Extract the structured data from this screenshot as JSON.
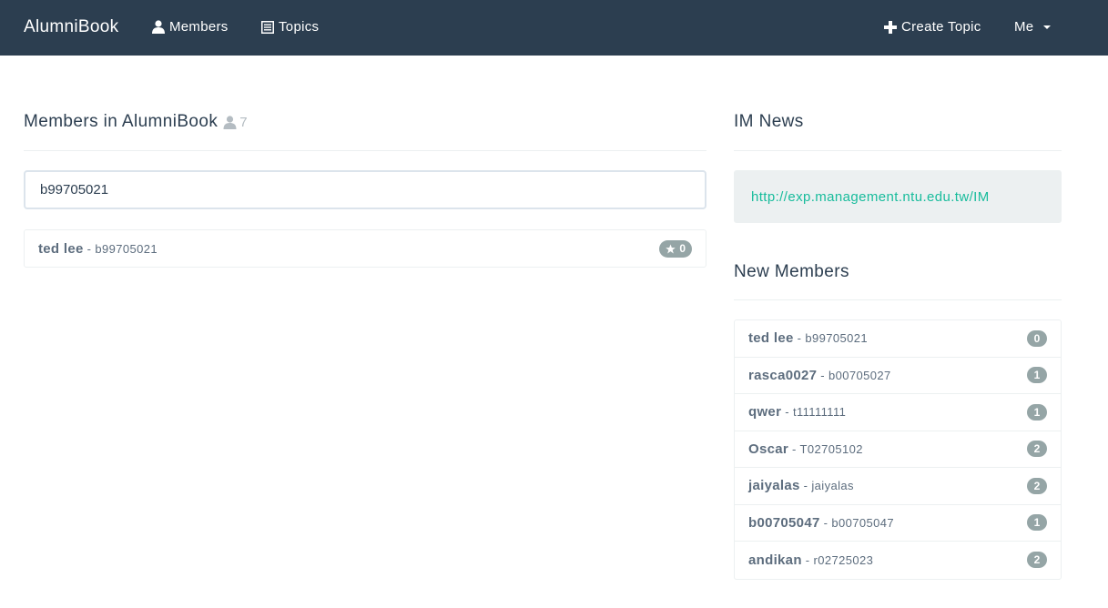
{
  "navbar": {
    "brand": "AlumniBook",
    "members_label": "Members",
    "topics_label": "Topics",
    "create_topic_label": "Create Topic",
    "me_label": "Me"
  },
  "members_section": {
    "title": "Members in AlumniBook",
    "count": "7",
    "search_value": "b99705021",
    "results": [
      {
        "name": "ted lee",
        "id": "- b99705021",
        "stars": "0"
      }
    ]
  },
  "news_section": {
    "title": "IM News",
    "link": "http://exp.management.ntu.edu.tw/IM"
  },
  "new_members_section": {
    "title": "New Members",
    "members": [
      {
        "name": "ted lee",
        "id": "- b99705021",
        "count": "0"
      },
      {
        "name": "rasca0027",
        "id": "- b00705027",
        "count": "1"
      },
      {
        "name": "qwer",
        "id": "- t11111111",
        "count": "1"
      },
      {
        "name": "Oscar",
        "id": "- T02705102",
        "count": "2"
      },
      {
        "name": "jaiyalas",
        "id": "- jaiyalas",
        "count": "2"
      },
      {
        "name": "b00705047",
        "id": "- b00705047",
        "count": "1"
      },
      {
        "name": "andikan",
        "id": "- r02725023",
        "count": "2"
      }
    ]
  },
  "colors": {
    "navbar_bg": "#2c3e50",
    "link": "#18bc9c",
    "badge": "#95a5a6"
  }
}
